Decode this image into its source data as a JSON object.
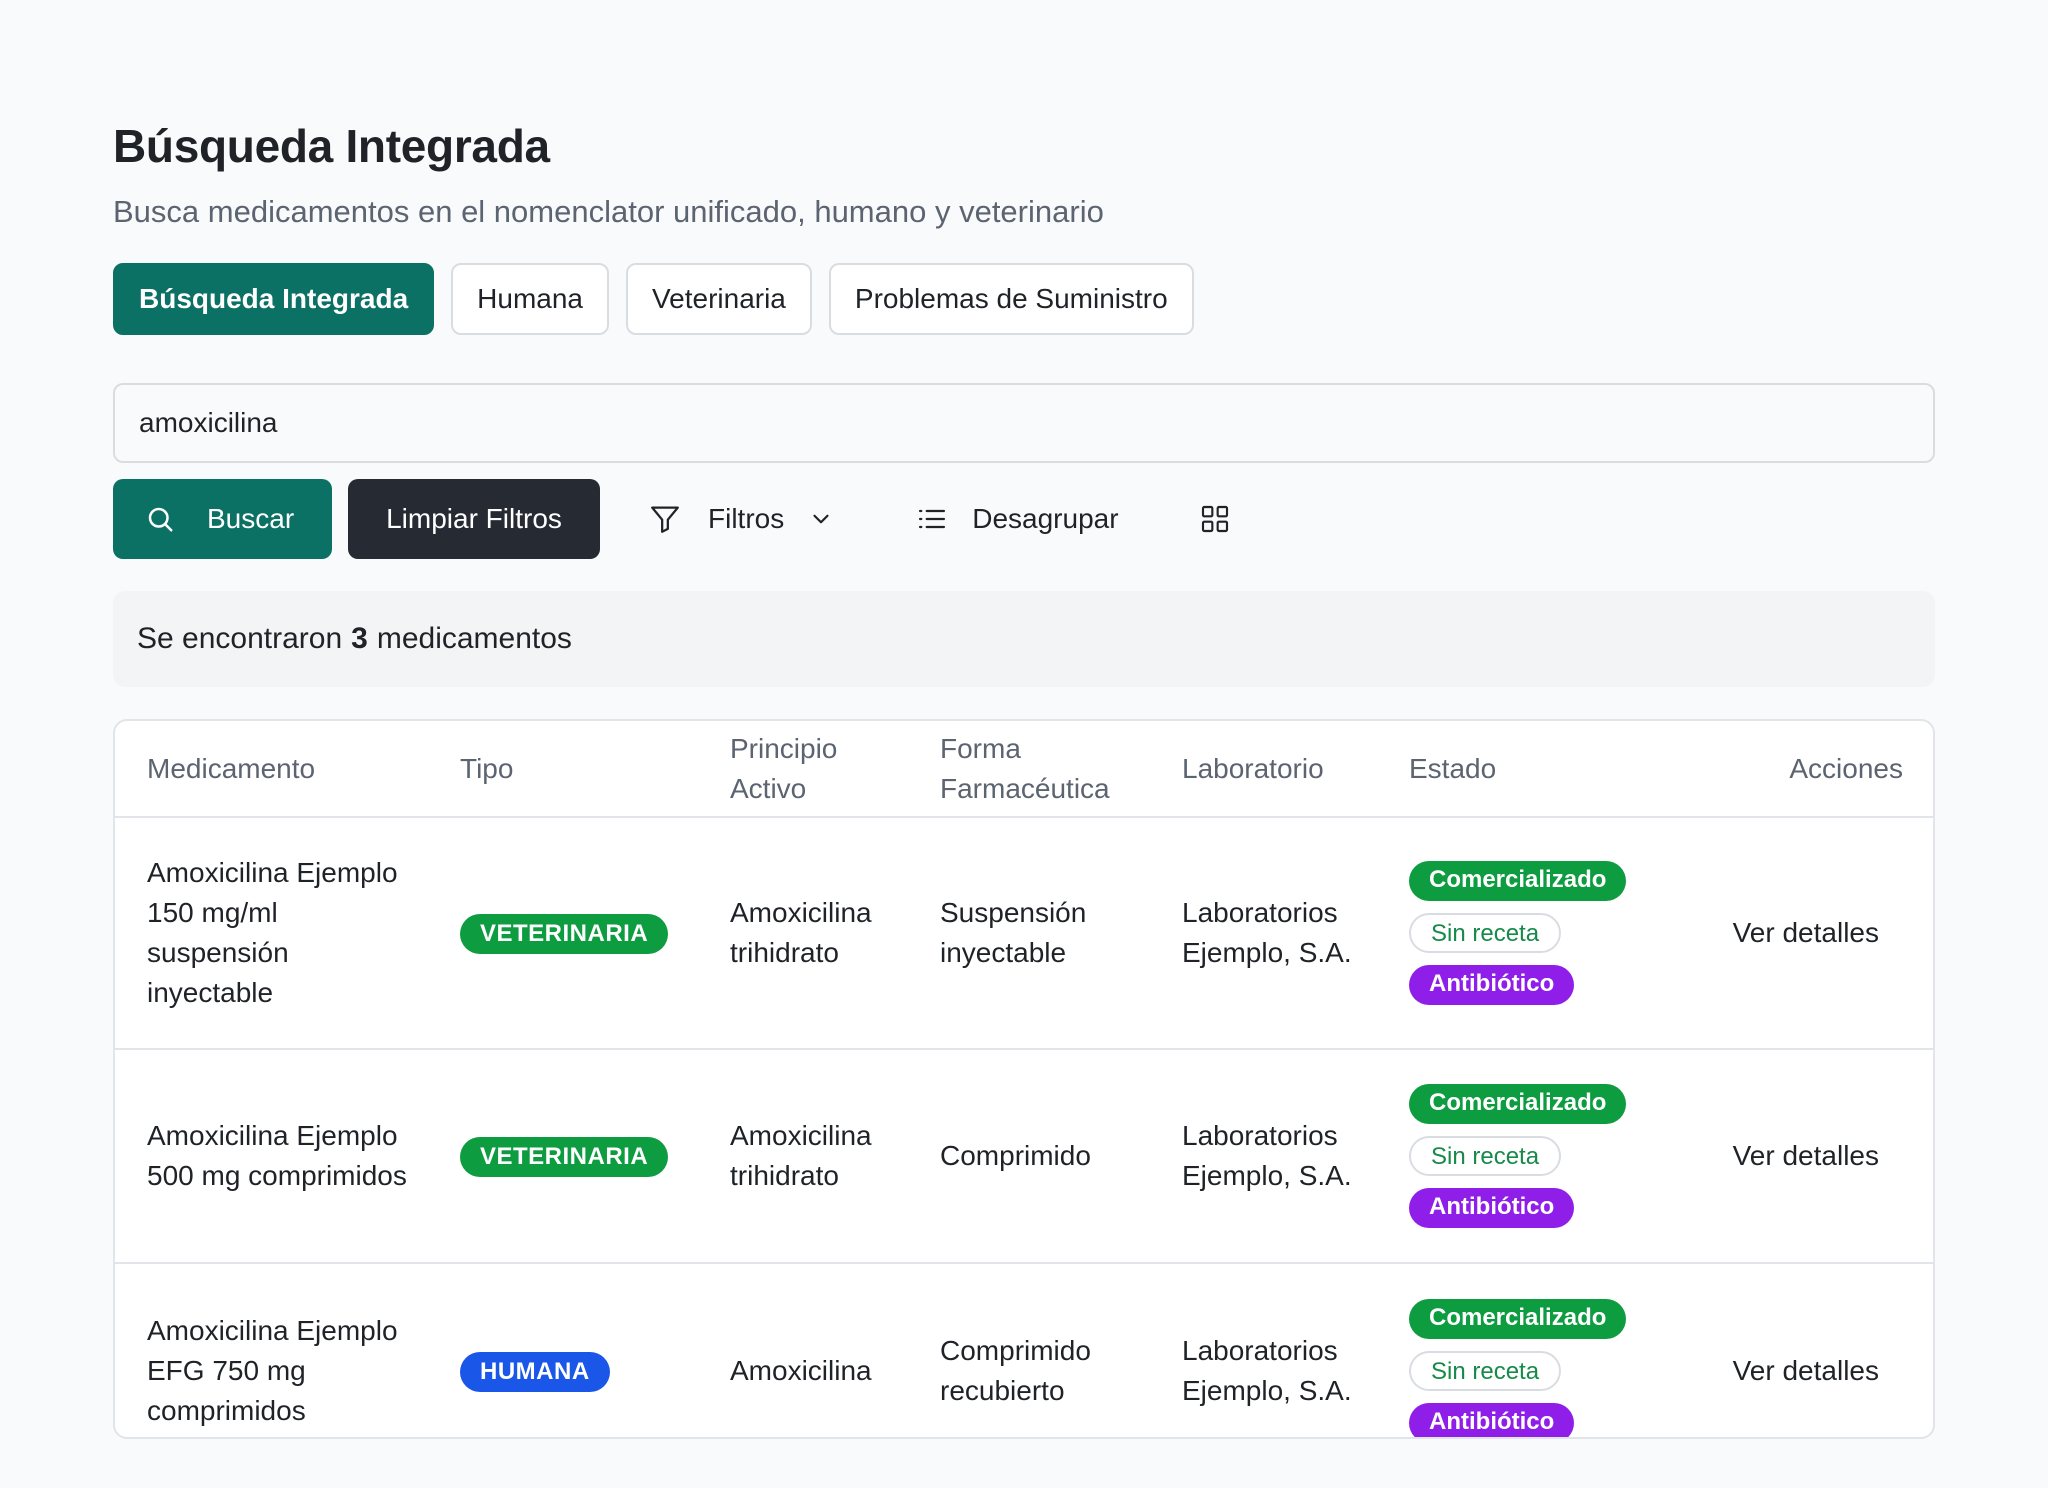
{
  "header": {
    "title": "Búsqueda Integrada",
    "subtitle": "Busca medicamentos en el nomenclator unificado, humano y veterinario"
  },
  "tabs": [
    {
      "label": "Búsqueda Integrada",
      "active": true
    },
    {
      "label": "Humana",
      "active": false
    },
    {
      "label": "Veterinaria",
      "active": false
    },
    {
      "label": "Problemas de Suministro",
      "active": false
    }
  ],
  "search": {
    "value": "amoxicilina"
  },
  "toolbar": {
    "search_label": "Buscar",
    "search_icon": "search-icon",
    "clear_label": "Limpiar Filtros",
    "filters_label": "Filtros",
    "filters_icon": "filter-icon",
    "ungroup_label": "Desagrupar",
    "ungroup_icon": "list-icon",
    "grid_icon": "grid-icon"
  },
  "results": {
    "prefix": "Se encontraron",
    "count": "3",
    "suffix": "medicamentos"
  },
  "table": {
    "headers": {
      "medicamento": "Medicamento",
      "tipo": "Tipo",
      "principio": "Principio Activo",
      "forma": "Forma Farmacéutica",
      "laboratorio": "Laboratorio",
      "estado": "Estado",
      "acciones": "Acciones"
    },
    "rows": [
      {
        "name": "Amoxicilina Ejemplo 150 mg/ml suspensión inyectable",
        "type": "VETERINARIA",
        "principle": "Amoxicilina trihidrato",
        "form": "Suspensión inyectable",
        "lab": "Laboratorios Ejemplo, S.A.",
        "status": [
          "Comercializado",
          "Sin receta",
          "Antibiótico"
        ],
        "action": "Ver detalles"
      },
      {
        "name": "Amoxicilina Ejemplo 500 mg comprimidos",
        "type": "VETERINARIA",
        "principle": "Amoxicilina trihidrato",
        "form": "Comprimido",
        "lab": "Laboratorios Ejemplo, S.A.",
        "status": [
          "Comercializado",
          "Sin receta",
          "Antibiótico"
        ],
        "action": "Ver detalles"
      },
      {
        "name": "Amoxicilina Ejemplo EFG 750 mg comprimidos",
        "type": "HUMANA",
        "principle": "Amoxicilina",
        "form": "Comprimido recubierto",
        "lab": "Laboratorios Ejemplo, S.A.",
        "status": [
          "Comercializado",
          "Sin receta",
          "Antibiótico"
        ],
        "action": "Ver detalles"
      }
    ]
  },
  "colors": {
    "primary": "#0b7165",
    "veterinaria_badge": "#0d9c40",
    "humana_badge": "#1a56e8",
    "status_green": "#0d9c40",
    "status_purple": "#8f1ee8",
    "dark_button": "#262a33"
  }
}
